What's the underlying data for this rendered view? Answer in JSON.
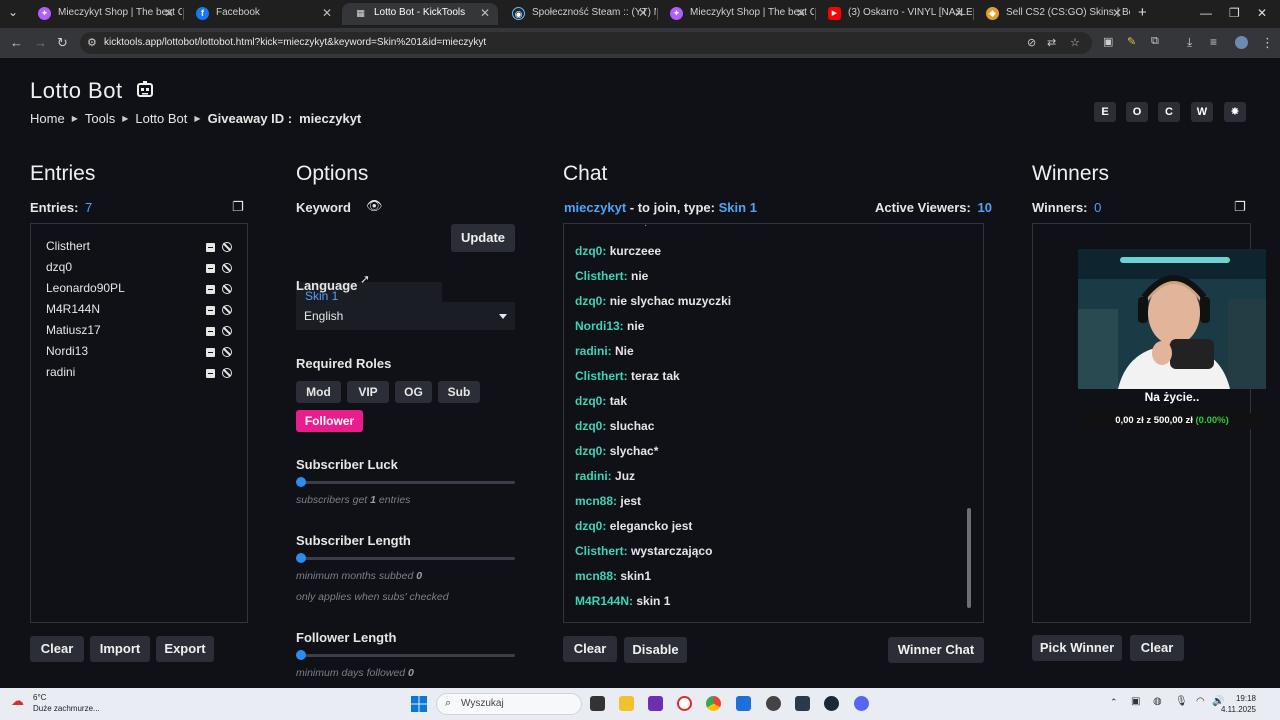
{
  "browser": {
    "tabs": [
      {
        "title": "Mieczykyt Shop | The best Cha",
        "icon": "shop-icon"
      },
      {
        "title": "Facebook",
        "icon": "facebook-icon"
      },
      {
        "title": "Lotto Bot - KickTools",
        "icon": "grid-icon"
      },
      {
        "title": "Społeczność Steam :: (YT) Mie",
        "icon": "steam-icon"
      },
      {
        "title": "Mieczykyt Shop | The best Cha",
        "icon": "shop-icon"
      },
      {
        "title": "(3) Oskarro - VINYL [NAJLE",
        "icon": "youtube-icon"
      },
      {
        "title": "Sell CS2 (CS:GO) Skins | Best C",
        "icon": "skins-icon"
      }
    ],
    "url": "kicktools.app/lottobot/lottobot.html?kick=mieczykyt&keyword=Skin%201&id=mieczykyt"
  },
  "header": {
    "title": "Lotto Bot",
    "breadcrumb": [
      "Home",
      "Tools",
      "Lotto Bot"
    ],
    "giveaway_label": "Giveaway ID :",
    "giveaway_id": "mieczykyt",
    "theme_buttons": [
      "E",
      "O",
      "C",
      "W",
      "✸"
    ]
  },
  "entries": {
    "title": "Entries",
    "count_label": "Entries:",
    "count": "7",
    "items": [
      "Clisthert",
      "dzq0",
      "Leonardo90PL",
      "M4R144N",
      "Matiusz17",
      "Nordi13",
      "radini"
    ],
    "buttons": {
      "clear": "Clear",
      "import": "Import",
      "export": "Export"
    }
  },
  "options": {
    "title": "Options",
    "keyword_label": "Keyword",
    "keyword_value": "Skin 1",
    "update_button": "Update",
    "language_label": "Language",
    "language_value": "English",
    "roles_label": "Required Roles",
    "roles": [
      {
        "label": "Mod",
        "active": false
      },
      {
        "label": "VIP",
        "active": false
      },
      {
        "label": "OG",
        "active": false
      },
      {
        "label": "Sub",
        "active": false
      },
      {
        "label": "Follower",
        "active": true
      }
    ],
    "subscriber_luck": {
      "label": "Subscriber Luck",
      "hint_pre": "subscribers get",
      "value": "1",
      "hint_post": "entries"
    },
    "subscriber_length": {
      "label": "Subscriber Length",
      "hint_pre": "minimum months subbed",
      "value": "0",
      "hint2": "only applies when subs' checked"
    },
    "follower_length": {
      "label": "Follower Length",
      "hint_pre": "minimum days followed",
      "value": "0"
    }
  },
  "chat": {
    "title": "Chat",
    "channel": "mieczykyt",
    "join_text": "- to join, type:",
    "keyword": "Skin 1",
    "viewers_label": "Active Viewers:",
    "viewers": "10",
    "messages": [
      {
        "user": "dzq0:",
        "text": "kurczeee"
      },
      {
        "user": "Clisthert:",
        "text": "nie"
      },
      {
        "user": "dzq0:",
        "text": "nie slychac muzyczki"
      },
      {
        "user": "Nordi13:",
        "text": "nie"
      },
      {
        "user": "radini:",
        "text": "Nie"
      },
      {
        "user": "Clisthert:",
        "text": "teraz tak"
      },
      {
        "user": "dzq0:",
        "text": "tak"
      },
      {
        "user": "dzq0:",
        "text": "sluchac"
      },
      {
        "user": "dzq0:",
        "text": "slychac*"
      },
      {
        "user": "radini:",
        "text": "Juz"
      },
      {
        "user": "mcn88:",
        "text": "jest"
      },
      {
        "user": "dzq0:",
        "text": "elegancko jest"
      },
      {
        "user": "Clisthert:",
        "text": "wystarczająco"
      },
      {
        "user": "mcn88:",
        "text": "skin1"
      },
      {
        "user": "M4R144N:",
        "text": "skin 1"
      }
    ],
    "buttons": {
      "clear": "Clear",
      "disable": "Disable",
      "winner_chat": "Winner Chat"
    }
  },
  "winners": {
    "title": "Winners",
    "count_label": "Winners:",
    "count": "0",
    "buttons": {
      "pick": "Pick Winner",
      "clear": "Clear"
    },
    "overlay_caption": "Na życie..",
    "overlay_goal": "0,00 zł z 500,00 zł",
    "overlay_pct": "(0.00%)"
  },
  "taskbar": {
    "weather_temp": "6°C",
    "weather_desc": "Duże zachmurze...",
    "search_placeholder": "Wyszukaj",
    "time": "19:18",
    "date": "4.11.2025"
  },
  "colors": {
    "accent_blue": "#4fa3f7",
    "chat_user": "#3fd3b5",
    "follower_pink": "#e91e8c",
    "slider_blue": "#2d8cf0"
  }
}
